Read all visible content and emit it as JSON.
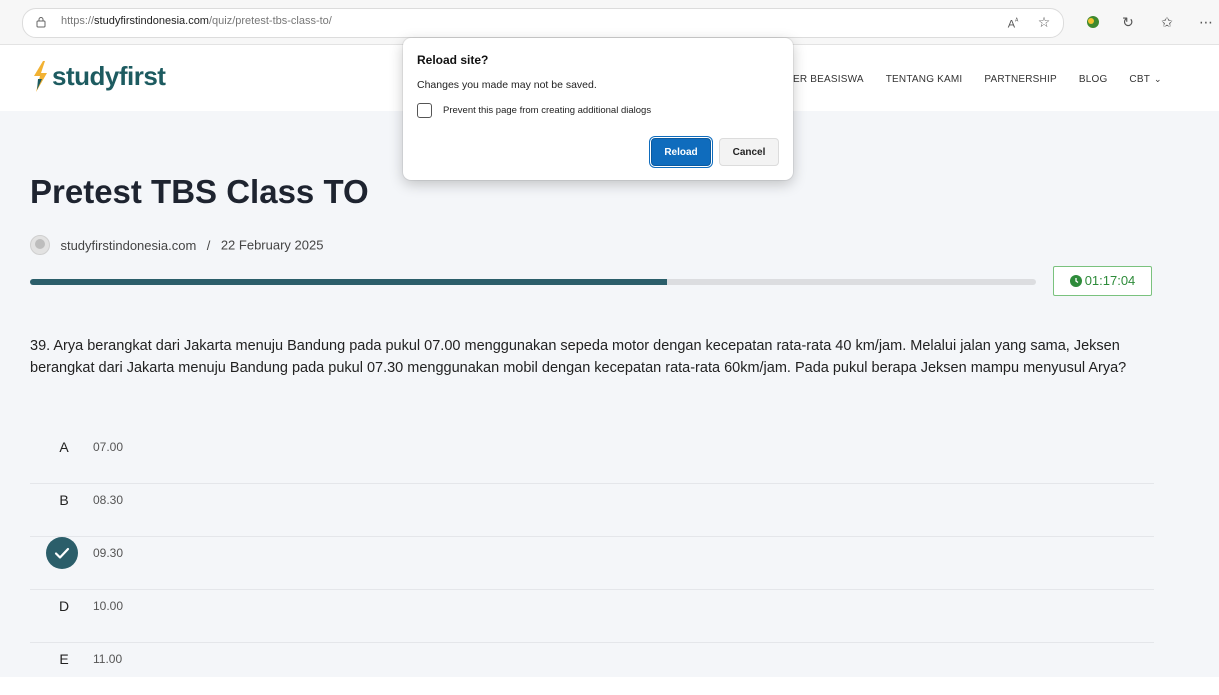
{
  "browser": {
    "url_prefix": "https://",
    "url_domain": "studyfirstindonesia.com",
    "url_path": "/quiz/pretest-tbs-class-to/",
    "toolbar_icons": [
      "read-aloud-icon",
      "favorite-star-icon",
      "extension-icon",
      "refresh-icon",
      "favorites-icon",
      "more-icon"
    ]
  },
  "site": {
    "logo_text": "studyfirst",
    "brand_color": "#1d5b60",
    "logo_accent": "#f2b233",
    "nav": [
      "ER BEASISWA",
      "TENTANG KAMI",
      "PARTNERSHIP",
      "BLOG",
      "CBT"
    ]
  },
  "page": {
    "title": "Pretest TBS Class TO",
    "author": "studyfirstindonesia.com",
    "separator": "/",
    "date": "22 February 2025"
  },
  "quiz": {
    "progress_fraction": 0.633,
    "progress_color": "#2b5e6a",
    "timer": "01:17:04",
    "question": "39. Arya berangkat dari Jakarta menuju Bandung pada pukul 07.00 menggunakan sepeda motor dengan kecepatan rata-rata 40 km/jam. Melalui jalan yang sama, Jeksen berangkat dari Jakarta menuju Bandung pada pukul 07.30 menggunakan mobil dengan kecepatan rata-rata 60km/jam. Pada pukul berapa Jeksen mampu menyusul Arya?",
    "options": [
      {
        "letter": "A",
        "value": "07.00",
        "selected": false
      },
      {
        "letter": "B",
        "value": "08.30",
        "selected": false
      },
      {
        "letter": "C",
        "value": "09.30",
        "selected": true
      },
      {
        "letter": "D",
        "value": "10.00",
        "selected": false
      },
      {
        "letter": "E",
        "value": "11.00",
        "selected": false
      }
    ]
  },
  "dialog": {
    "title": "Reload site?",
    "message": "Changes you made may not be saved.",
    "checkbox_label": "Prevent this page from creating additional dialogs",
    "reload_label": "Reload",
    "cancel_label": "Cancel"
  }
}
